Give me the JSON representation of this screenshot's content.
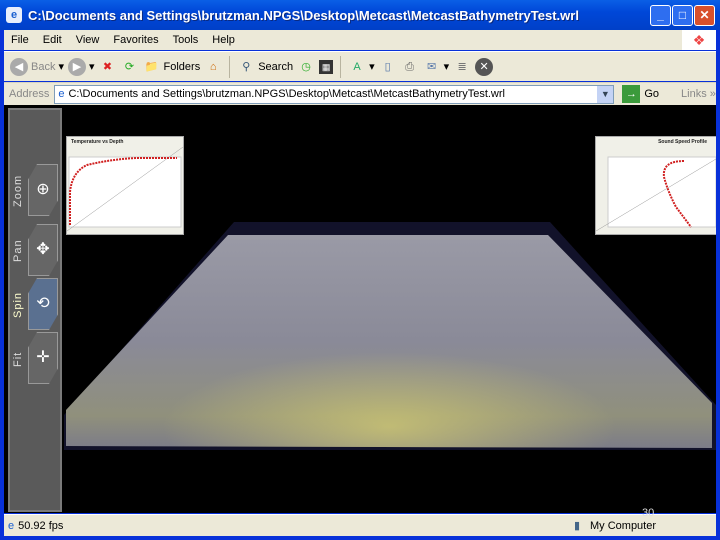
{
  "window": {
    "title": "C:\\Documents and Settings\\brutzman.NPGS\\Desktop\\Metcast\\MetcastBathymetryTest.wrl"
  },
  "menu": [
    "File",
    "Edit",
    "View",
    "Favorites",
    "Tools",
    "Help"
  ],
  "toolbar": {
    "back": "Back",
    "folders": "Folders",
    "search": "Search"
  },
  "address": {
    "label": "Address",
    "value": "C:\\Documents and Settings\\brutzman.NPGS\\Desktop\\Metcast\\MetcastBathymetryTest.wrl",
    "go": "Go",
    "links": "Links"
  },
  "nav": [
    "Zoom",
    "Pan",
    "Spin",
    "Fit"
  ],
  "charts": {
    "left_title": "Temperature vs Depth",
    "right_title": "Sound Speed Profile"
  },
  "status": {
    "fps": "50.92 fps",
    "zone": "My Computer"
  },
  "slide_number": "30"
}
